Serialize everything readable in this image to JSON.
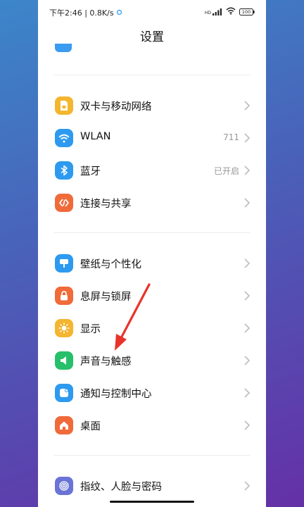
{
  "status_bar": {
    "time_speed": "下午2:46 | 0.8K/s",
    "hd_label": "HD",
    "battery": "100"
  },
  "header": {
    "title": "设置"
  },
  "colors": {
    "sim": "#f4b52f",
    "wlan": "#2d9af0",
    "bluetooth": "#2d9af0",
    "share": "#f06a3a",
    "wallpaper": "#2d9af0",
    "lockscreen": "#f06a3a",
    "display": "#f4b52f",
    "sound": "#26c06a",
    "notification": "#2d9af0",
    "desktop": "#f06a3a",
    "fingerprint": "#6a74d6",
    "annotation_arrow": "#e8332a"
  },
  "settings": {
    "sim": {
      "label": "双卡与移动网络",
      "icon": "sim-card-icon"
    },
    "wlan": {
      "label": "WLAN",
      "value": "711",
      "icon": "wifi-icon"
    },
    "bluetooth": {
      "label": "蓝牙",
      "value": "已开启",
      "icon": "bluetooth-icon"
    },
    "share": {
      "label": "连接与共享",
      "icon": "connection-share-icon"
    },
    "wallpaper": {
      "label": "壁纸与个性化",
      "icon": "wallpaper-icon"
    },
    "lockscreen": {
      "label": "息屏与锁屏",
      "icon": "lock-icon"
    },
    "display": {
      "label": "显示",
      "icon": "sun-icon"
    },
    "sound": {
      "label": "声音与触感",
      "icon": "speaker-icon"
    },
    "notification": {
      "label": "通知与控制中心",
      "icon": "notification-icon"
    },
    "desktop": {
      "label": "桌面",
      "icon": "home-icon"
    },
    "fingerprint": {
      "label": "指纹、人脸与密码",
      "icon": "fingerprint-icon"
    }
  }
}
